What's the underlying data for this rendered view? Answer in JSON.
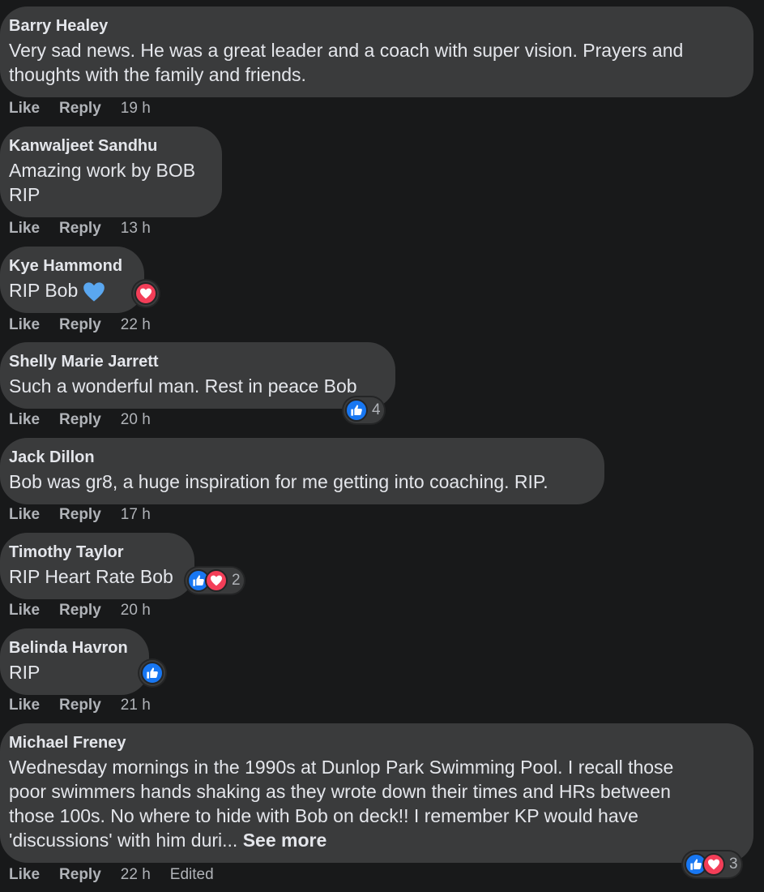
{
  "actions": {
    "like_label": "Like",
    "reply_label": "Reply",
    "edited_label": "Edited"
  },
  "colors": {
    "background": "#18191a",
    "bubble": "#3a3b3c",
    "like_blue": "#1877f2",
    "love_red": "#f33e58",
    "heart_emoji": "#5aa7f0"
  },
  "comments": [
    {
      "author": "Barry Healey",
      "lines": [
        "Very sad news. He was a great leader and a coach with super vision. Prayers and",
        "thoughts with the family and friends."
      ],
      "time": "19 h"
    },
    {
      "author": "Kanwaljeet Sandhu",
      "lines": [
        "Amazing work by BOB",
        "RIP"
      ],
      "time": "13 h"
    },
    {
      "author": "Kye Hammond",
      "lines": [
        "RIP Bob"
      ],
      "emoji": "blue-heart-emoji",
      "time": "22 h",
      "reactions": [
        "love-icon"
      ]
    },
    {
      "author": "Shelly Marie Jarrett",
      "lines": [
        "Such a wonderful man. Rest in peace Bob"
      ],
      "time": "20 h",
      "reactions": [
        "like-icon"
      ],
      "reaction_count": "4"
    },
    {
      "author": "Jack Dillon",
      "lines": [
        "Bob was gr8, a huge inspiration for me getting into coaching. RIP."
      ],
      "time": "17 h"
    },
    {
      "author": "Timothy Taylor",
      "lines": [
        "RIP Heart Rate Bob"
      ],
      "time": "20 h",
      "reactions": [
        "like-icon",
        "love-icon"
      ],
      "reaction_count": "2"
    },
    {
      "author": "Belinda Havron",
      "lines": [
        "RIP"
      ],
      "time": "21 h",
      "reactions": [
        "like-icon"
      ]
    },
    {
      "author": "Michael Freney",
      "lines": [
        "Wednesday mornings in the 1990s at Dunlop Park Swimming Pool. I recall those",
        "poor swimmers hands shaking as they wrote down their times and HRs between",
        "those 100s. No where to hide with Bob on deck!! I remember KP would have",
        "'discussions' with him duri... "
      ],
      "see_more": "See more",
      "time": "22 h",
      "edited": true,
      "reactions": [
        "like-icon",
        "love-icon"
      ],
      "reaction_count": "3"
    }
  ]
}
